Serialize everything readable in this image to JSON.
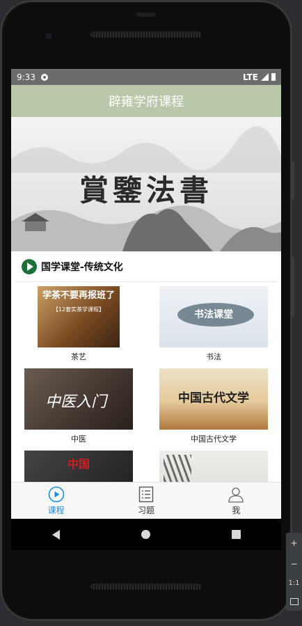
{
  "status_bar": {
    "time": "9:33",
    "network": "LTE"
  },
  "app_title": "辟雍学府课程",
  "banner": {
    "text": "賞鑒法書"
  },
  "section": {
    "title": "国学课堂-传统文化"
  },
  "courses": [
    {
      "label": "茶艺",
      "thumb_caption": "学茶不要再报班了",
      "thumb_subcaption": "【12套实茶学课程】"
    },
    {
      "label": "书法",
      "thumb_caption": "书法课堂"
    },
    {
      "label": "中医",
      "thumb_caption": "中医入门"
    },
    {
      "label": "中国古代文学",
      "thumb_caption": "中国古代文学"
    },
    {
      "label": "",
      "thumb_caption": "中国"
    },
    {
      "label": "",
      "thumb_caption": ""
    }
  ],
  "tabs": [
    {
      "label": "课程",
      "icon": "play-circle-icon",
      "active": true
    },
    {
      "label": "习题",
      "icon": "list-icon",
      "active": false
    },
    {
      "label": "我",
      "icon": "person-icon",
      "active": false
    }
  ],
  "emulator_toolbar": {
    "zoom_in": "+",
    "zoom_out": "−",
    "ratio": "1:1"
  },
  "colors": {
    "title_bar": "#b9c8a8",
    "status_bar": "#6b6b6b",
    "active_tab": "#1a8fe3",
    "section_icon": "#1b6f3a"
  }
}
